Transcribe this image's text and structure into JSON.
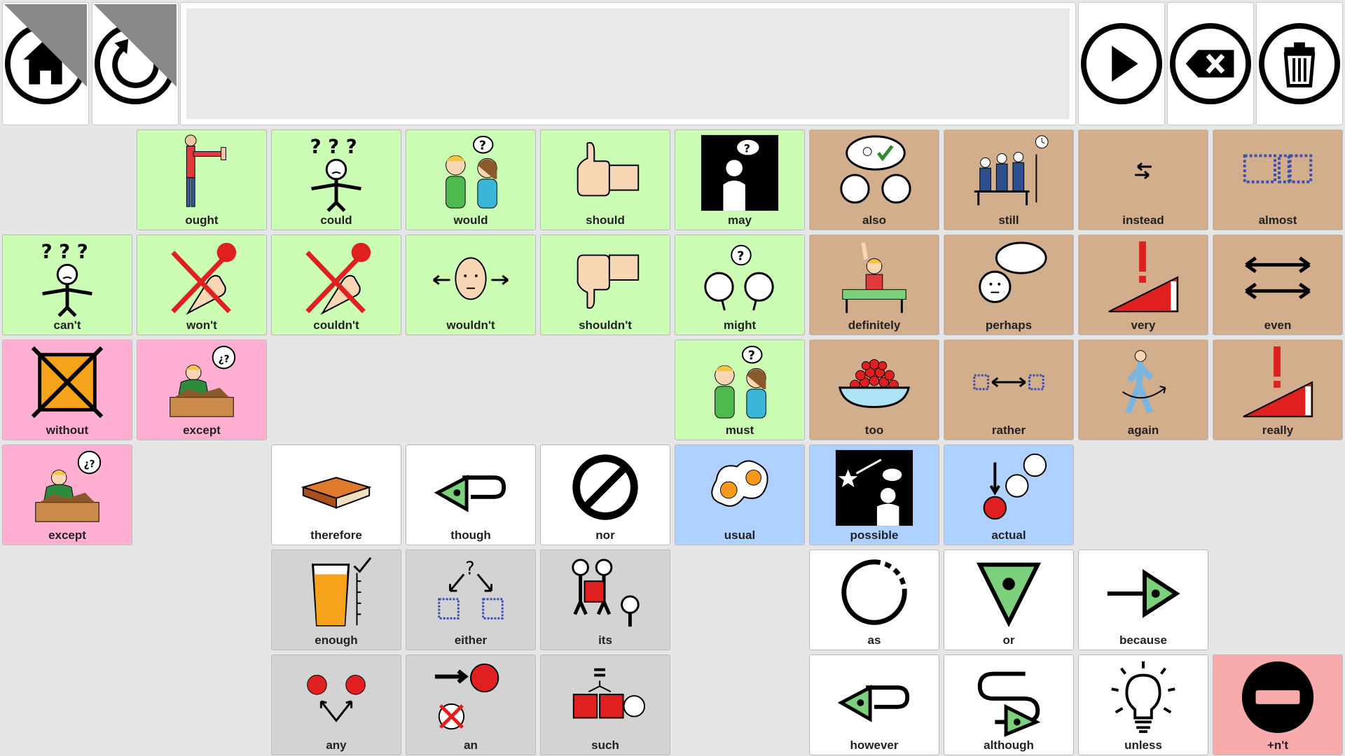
{
  "toolbar": {
    "home_icon": "home-icon",
    "undo_icon": "undo-icon",
    "speak_icon": "play-icon",
    "backspace_icon": "backspace-icon",
    "clear_icon": "trash-icon"
  },
  "message_bar": {
    "text": ""
  },
  "colors": {
    "verb": "#ccfdb5",
    "adverb": "#d3ae8d",
    "preposition": "#ffafd2",
    "conjunction": "#ffffff",
    "adjective": "#afd1ff",
    "determiner": "#d3d3d3",
    "negation": "#f9aaaa"
  },
  "cells": [
    {
      "label": "ought",
      "icon": "stop-hand-person-icon"
    },
    {
      "label": "could",
      "icon": "confused-person-icon"
    },
    {
      "label": "would",
      "icon": "two-people-question-icon"
    },
    {
      "label": "should",
      "icon": "thumbs-up-icon"
    },
    {
      "label": "may",
      "icon": "person-thinking-question-icon"
    },
    {
      "label": "also",
      "icon": "two-heads-agree-icon"
    },
    {
      "label": "still",
      "icon": "people-waiting-clock-icon"
    },
    {
      "label": "instead",
      "icon": "swap-arrows-icon"
    },
    {
      "label": "almost",
      "icon": "dotted-boxes-icon"
    },
    {
      "label": "can't",
      "icon": "confused-person-icon"
    },
    {
      "label": "won't",
      "icon": "cross-hand-icon"
    },
    {
      "label": "couldn't",
      "icon": "cross-hand-icon"
    },
    {
      "label": "wouldn't",
      "icon": "head-left-right-icon"
    },
    {
      "label": "shouldn't",
      "icon": "thumbs-down-icon"
    },
    {
      "label": "might",
      "icon": "two-heads-question-icon"
    },
    {
      "label": "definitely",
      "icon": "student-hand-up-icon"
    },
    {
      "label": "perhaps",
      "icon": "head-thought-bubble-icon"
    },
    {
      "label": "very",
      "icon": "exclamation-wedge-icon"
    },
    {
      "label": "even",
      "icon": "double-arrows-icon"
    },
    {
      "label": "without",
      "icon": "crossed-box-icon"
    },
    {
      "label": "except",
      "icon": "sorting-person-icon"
    },
    {
      "label": "must",
      "icon": "two-people-question-icon"
    },
    {
      "label": "too",
      "icon": "bowl-of-berries-icon"
    },
    {
      "label": "rather",
      "icon": "box-arrow-box-icon"
    },
    {
      "label": "again",
      "icon": "person-walking-around-icon"
    },
    {
      "label": "really",
      "icon": "exclamation-wedge-icon"
    },
    {
      "label": "except",
      "icon": "sorting-person-icon"
    },
    {
      "label": "therefore",
      "icon": "book-icon"
    },
    {
      "label": "though",
      "icon": "loop-arrow-icon"
    },
    {
      "label": "nor",
      "icon": "prohibited-icon"
    },
    {
      "label": "usual",
      "icon": "fried-eggs-icon"
    },
    {
      "label": "possible",
      "icon": "shooting-star-icon"
    },
    {
      "label": "actual",
      "icon": "circles-arrow-icon"
    },
    {
      "label": "enough",
      "icon": "full-glass-icon"
    },
    {
      "label": "either",
      "icon": "choice-boxes-icon"
    },
    {
      "label": "its",
      "icon": "people-holding-box-icon"
    },
    {
      "label": "as",
      "icon": "dashed-circle-icon"
    },
    {
      "label": "or",
      "icon": "triangle-down-icon"
    },
    {
      "label": "because",
      "icon": "arrow-to-triangle-icon"
    },
    {
      "label": "any",
      "icon": "two-dots-arrows-icon"
    },
    {
      "label": "an",
      "icon": "arrow-dot-cross-icon"
    },
    {
      "label": "such",
      "icon": "equal-squares-icon"
    },
    {
      "label": "however",
      "icon": "loop-arrow-icon"
    },
    {
      "label": "although",
      "icon": "wiggle-arrow-icon"
    },
    {
      "label": "unless",
      "icon": "lightbulb-icon"
    },
    {
      "label": "+n't",
      "icon": "minus-circle-icon"
    }
  ]
}
